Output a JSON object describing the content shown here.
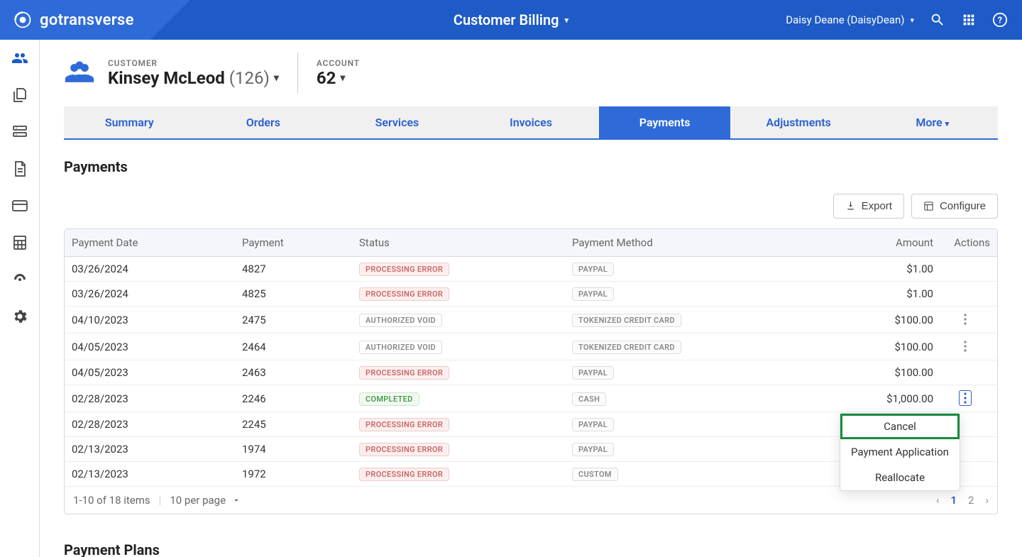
{
  "brand": "gotransverse",
  "header_center": "Customer Billing",
  "user_name": "Daisy Deane (DaisyDean)",
  "context": {
    "customer_label": "CUSTOMER",
    "customer_name": "Kinsey McLeod",
    "customer_id_display": "(126)",
    "account_label": "ACCOUNT",
    "account_number": "62"
  },
  "tabs": [
    "Summary",
    "Orders",
    "Services",
    "Invoices",
    "Payments",
    "Adjustments",
    "More"
  ],
  "tabs_active_idx": 4,
  "section_title": "Payments",
  "buttons": {
    "export": "Export",
    "configure": "Configure"
  },
  "columns": [
    "Payment Date",
    "Payment",
    "Status",
    "Payment Method",
    "Amount",
    "Actions"
  ],
  "rows": [
    {
      "date": "03/26/2024",
      "payment": "4827",
      "status": "PROCESSING ERROR",
      "status_type": "error",
      "method": "PAYPAL",
      "amount": "$1.00",
      "menu": false
    },
    {
      "date": "03/26/2024",
      "payment": "4825",
      "status": "PROCESSING ERROR",
      "status_type": "error",
      "method": "PAYPAL",
      "amount": "$1.00",
      "menu": false
    },
    {
      "date": "04/10/2023",
      "payment": "2475",
      "status": "AUTHORIZED VOID",
      "status_type": "void",
      "method": "TOKENIZED CREDIT CARD",
      "amount": "$100.00",
      "menu": true
    },
    {
      "date": "04/05/2023",
      "payment": "2464",
      "status": "AUTHORIZED VOID",
      "status_type": "void",
      "method": "TOKENIZED CREDIT CARD",
      "amount": "$100.00",
      "menu": true
    },
    {
      "date": "04/05/2023",
      "payment": "2463",
      "status": "PROCESSING ERROR",
      "status_type": "error",
      "method": "PAYPAL",
      "amount": "$100.00",
      "menu": false
    },
    {
      "date": "02/28/2023",
      "payment": "2246",
      "status": "COMPLETED",
      "status_type": "completed",
      "method": "CASH",
      "amount": "$1,000.00",
      "menu": true,
      "menu_open": true
    },
    {
      "date": "02/28/2023",
      "payment": "2245",
      "status": "PROCESSING ERROR",
      "status_type": "error",
      "method": "PAYPAL",
      "amount": "",
      "menu": false
    },
    {
      "date": "02/13/2023",
      "payment": "1974",
      "status": "PROCESSING ERROR",
      "status_type": "error",
      "method": "PAYPAL",
      "amount": "",
      "menu": false
    },
    {
      "date": "02/13/2023",
      "payment": "1972",
      "status": "PROCESSING ERROR",
      "status_type": "error",
      "method": "CUSTOM",
      "amount": "",
      "menu": false
    }
  ],
  "dropdown_items": [
    "Cancel",
    "Payment Application",
    "Reallocate"
  ],
  "dropdown_highlight_idx": 0,
  "footer": {
    "range": "1-10 of 18 items",
    "perpage": "10 per page"
  },
  "pages": [
    "1",
    "2"
  ],
  "active_page_idx": 0,
  "section_title2": "Payment Plans"
}
